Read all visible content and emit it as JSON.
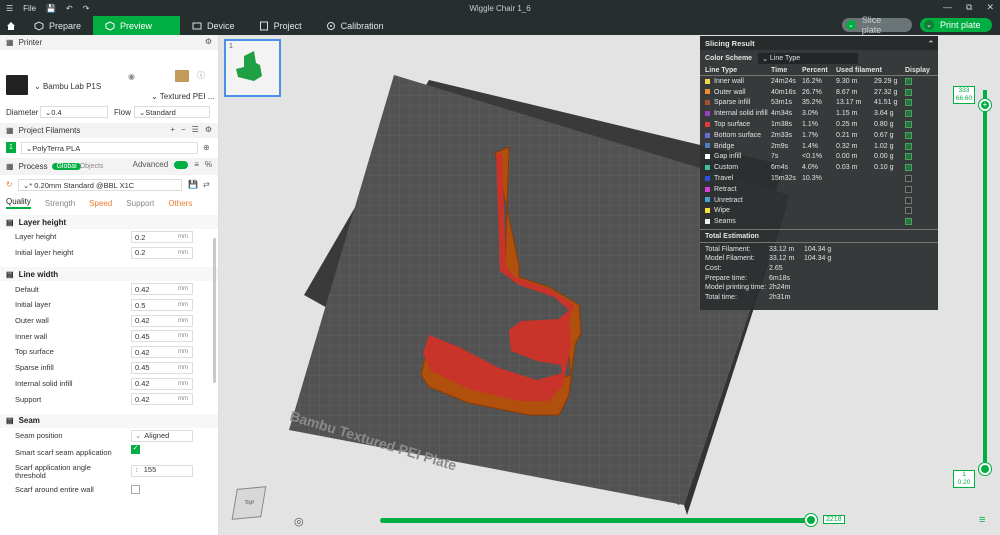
{
  "app": {
    "menu_label": "File",
    "window_title": "Wiggle Chair 1_6"
  },
  "nav": {
    "prepare": "Prepare",
    "preview": "Preview",
    "device": "Device",
    "project": "Project",
    "calibration": "Calibration",
    "slice_plate": "Slice plate",
    "print_plate": "Print plate"
  },
  "printer": {
    "section": "Printer",
    "name": "Bambu Lab P1S",
    "plate": "Textured PEI ...",
    "diameter_label": "Diameter",
    "diameter_value": "0.4",
    "flow_label": "Flow",
    "flow_value": "Standard"
  },
  "filaments": {
    "section": "Project Filaments",
    "slot": "1",
    "filament": "PolyTerra PLA"
  },
  "process": {
    "section": "Process",
    "toggle_global": "Global",
    "toggle_objects": "Objects",
    "advanced": "Advanced",
    "preset": "* 0.20mm Standard @BBL X1C"
  },
  "tabs": [
    "Quality",
    "Strength",
    "Speed",
    "Support",
    "Others"
  ],
  "layer_height": {
    "title": "Layer height",
    "params": [
      {
        "label": "Layer height",
        "value": "0.2",
        "unit": "mm"
      },
      {
        "label": "Initial layer height",
        "value": "0.2",
        "unit": "mm"
      }
    ]
  },
  "line_width": {
    "title": "Line width",
    "params": [
      {
        "label": "Default",
        "value": "0.42",
        "unit": "mm"
      },
      {
        "label": "Initial layer",
        "value": "0.5",
        "unit": "mm"
      },
      {
        "label": "Outer wall",
        "value": "0.42",
        "unit": "mm"
      },
      {
        "label": "Inner wall",
        "value": "0.45",
        "unit": "mm"
      },
      {
        "label": "Top surface",
        "value": "0.42",
        "unit": "mm"
      },
      {
        "label": "Sparse infill",
        "value": "0.45",
        "unit": "mm"
      },
      {
        "label": "Internal solid infill",
        "value": "0.42",
        "unit": "mm"
      },
      {
        "label": "Support",
        "value": "0.42",
        "unit": "mm"
      }
    ]
  },
  "seam": {
    "title": "Seam",
    "position_label": "Seam position",
    "position_value": "Aligned",
    "scarf_label": "Smart scarf seam application",
    "scarf_angle_label": "Scarf application angle threshold",
    "scarf_angle_value": "155",
    "scarf_entire_label": "Scarf around entire wall"
  },
  "plate": {
    "index": "1",
    "bed_label": "Bambu Textured PEI Plate"
  },
  "slicing": {
    "title": "Slicing Result",
    "scheme_label": "Color Scheme",
    "scheme_value": "Line Type",
    "headers": [
      "Line Type",
      "Time",
      "Percent",
      "Used filament",
      "Display"
    ],
    "rows": [
      {
        "name": "Inner wall",
        "time": "24m24s",
        "pct": "16.2%",
        "len": "9.30 m",
        "wt": "29.29 g",
        "color": "#f4d64b",
        "on": true
      },
      {
        "name": "Outer wall",
        "time": "40m16s",
        "pct": "26.7%",
        "len": "8.67 m",
        "wt": "27.32 g",
        "color": "#f08a2a",
        "on": true
      },
      {
        "name": "Sparse infill",
        "time": "53m1s",
        "pct": "35.2%",
        "len": "13.17 m",
        "wt": "41.51 g",
        "color": "#a85030",
        "on": true
      },
      {
        "name": "Internal solid infill",
        "time": "4m34s",
        "pct": "3.0%",
        "len": "1.15 m",
        "wt": "3.64 g",
        "color": "#9b3fc4",
        "on": true
      },
      {
        "name": "Top surface",
        "time": "1m38s",
        "pct": "1.1%",
        "len": "0.25 m",
        "wt": "0.80 g",
        "color": "#e03a3a",
        "on": true
      },
      {
        "name": "Bottom surface",
        "time": "2m33s",
        "pct": "1.7%",
        "len": "0.21 m",
        "wt": "0.67 g",
        "color": "#6b6bd6",
        "on": true
      },
      {
        "name": "Bridge",
        "time": "2m9s",
        "pct": "1.4%",
        "len": "0.32 m",
        "wt": "1.02 g",
        "color": "#4b7fc2",
        "on": true
      },
      {
        "name": "Gap infill",
        "time": "7s",
        "pct": "<0.1%",
        "len": "0.00 m",
        "wt": "0.00 g",
        "color": "#ffffff",
        "on": true
      },
      {
        "name": "Custom",
        "time": "6m4s",
        "pct": "4.0%",
        "len": "0.03 m",
        "wt": "0.10 g",
        "color": "#3fbf9f",
        "on": true
      },
      {
        "name": "Travel",
        "time": "15m32s",
        "pct": "10.3%",
        "len": "",
        "wt": "",
        "color": "#2f4fd8",
        "on": false
      },
      {
        "name": "Retract",
        "time": "",
        "pct": "",
        "len": "",
        "wt": "",
        "color": "#d63fd6",
        "on": false
      },
      {
        "name": "Unretract",
        "time": "",
        "pct": "",
        "len": "",
        "wt": "",
        "color": "#3fa7d6",
        "on": false
      },
      {
        "name": "Wipe",
        "time": "",
        "pct": "",
        "len": "",
        "wt": "",
        "color": "#f4e23b",
        "on": false
      },
      {
        "name": "Seams",
        "time": "",
        "pct": "",
        "len": "",
        "wt": "",
        "color": "#f0f0f0",
        "on": true
      }
    ],
    "estimation_title": "Total Estimation",
    "estimation": [
      {
        "label": "Total Filament:",
        "v1": "33.12 m",
        "v2": "104.34 g"
      },
      {
        "label": "Model Filament:",
        "v1": "33.12 m",
        "v2": "104.34 g"
      },
      {
        "label": "Cost:",
        "v1": "2.65",
        "v2": ""
      },
      {
        "label": "Prepare time:",
        "v1": "6m18s",
        "v2": ""
      },
      {
        "label": "Model printing time:",
        "v1": "2h24m",
        "v2": ""
      },
      {
        "label": "Total time:",
        "v1": "2h31m",
        "v2": ""
      }
    ]
  },
  "layers": {
    "top_layer": "333",
    "top_height": "66.60",
    "bottom_layer": "1",
    "bottom_height": "0.20",
    "move_value": "2218"
  }
}
